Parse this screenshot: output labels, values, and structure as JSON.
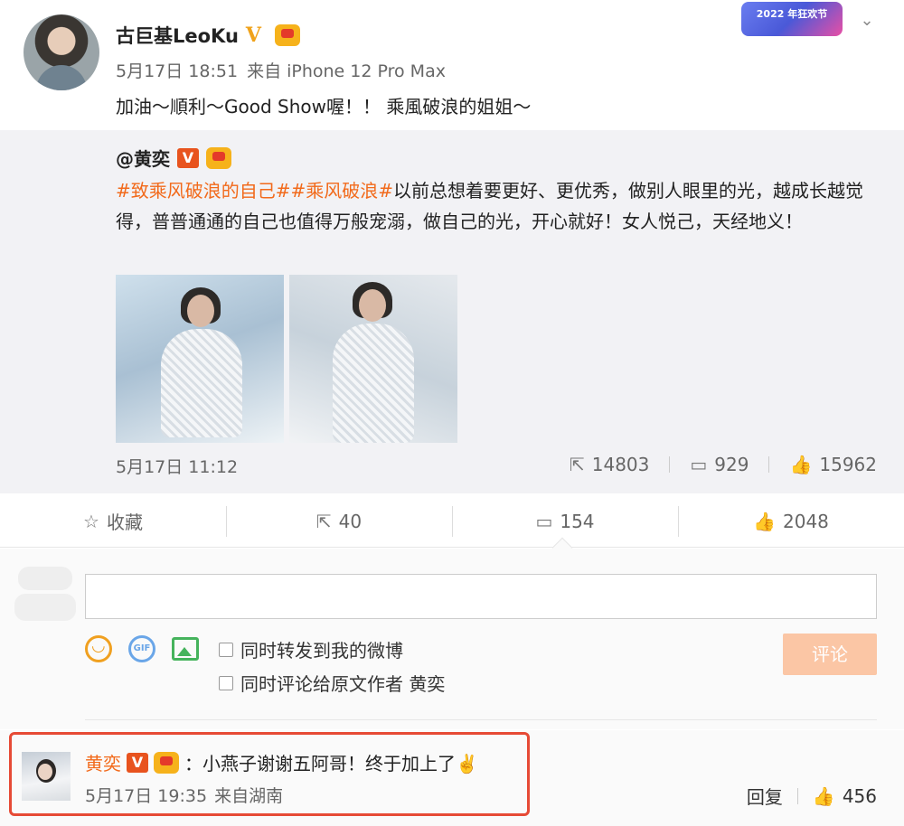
{
  "post": {
    "author": "古巨基LeoKu",
    "time": "5月17日 18:51",
    "source": "来自 iPhone 12 Pro Max",
    "text": "加油～順利～Good Show喔！！ 乘風破浪的姐姐～",
    "event_badge": "2022 年狂欢节"
  },
  "repost": {
    "author": "@黄奕",
    "hashtag1": "#致乘风破浪的自己#",
    "hashtag2": "#乘风破浪#",
    "text": "以前总想着要更好、更优秀，做别人眼里的光，越成长越觉得，普普通通的自己也值得万般宠溺，做自己的光，开心就好！女人悦己，天经地义！",
    "time": "5月17日 11:12",
    "reposts": "14803",
    "comments": "929",
    "likes": "15962"
  },
  "actions": {
    "favorite": "收藏",
    "repost": "40",
    "comment": "154",
    "like": "2048"
  },
  "composer": {
    "input_value": "",
    "option1": "同时转发到我的微博",
    "option2": "同时评论给原文作者 黄奕",
    "submit": "评论"
  },
  "comment": {
    "author": "黄奕",
    "text": "：小燕子谢谢五阿哥！终于加上了✌️",
    "time": "5月17日 19:35",
    "source": "来自湖南",
    "reply": "回复",
    "likes": "456"
  },
  "colors": {
    "hashtag": "#f26a1b",
    "highlight": "#e64a35",
    "submit_disabled": "#fbc6a5"
  },
  "icons": [
    "chevron-down-icon",
    "star-icon",
    "repost-icon",
    "comment-icon",
    "like-icon",
    "smile-icon",
    "gif-icon",
    "image-icon"
  ]
}
